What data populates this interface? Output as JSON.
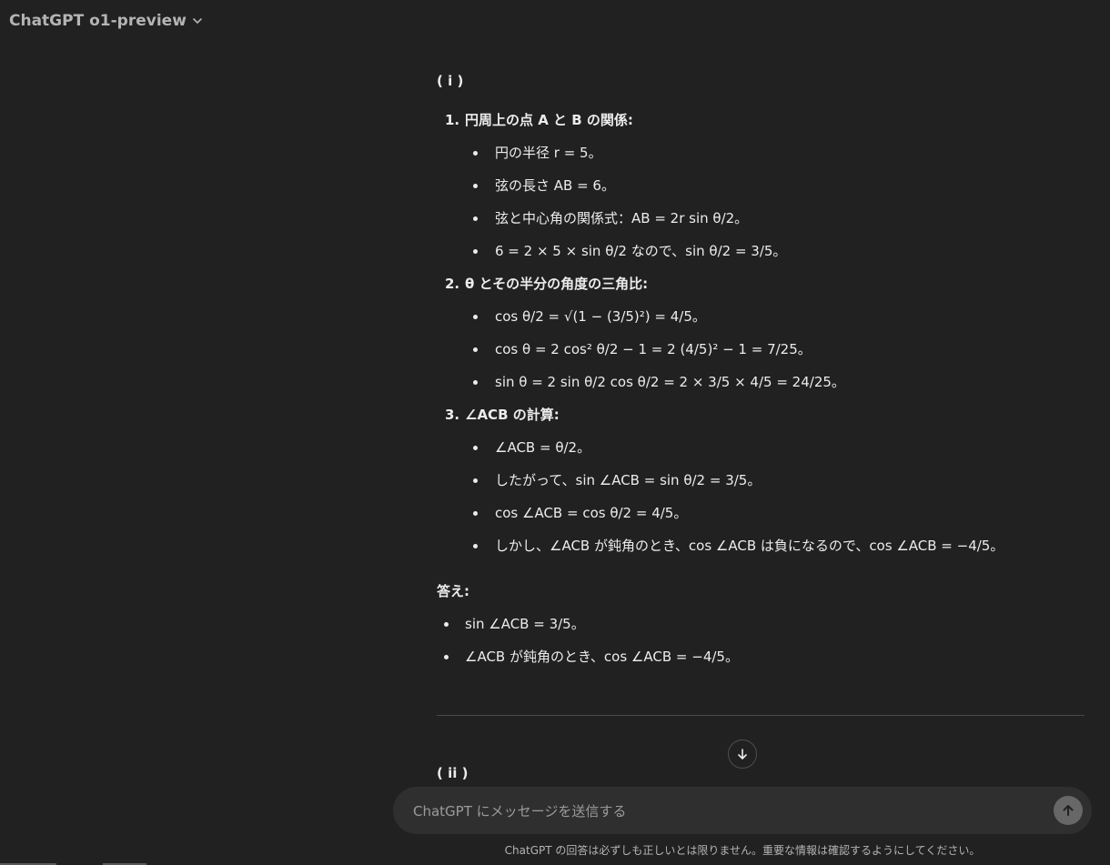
{
  "header": {
    "model_label": "ChatGPT o1-preview",
    "chevron_icon": "chevron-down-icon"
  },
  "message": {
    "section_i": "( i )",
    "steps": [
      {
        "number": "1.",
        "title": "円周上の点 A と B の関係:",
        "bullets": [
          "円の半径 r = 5。",
          "弦の長さ AB = 6。",
          "弦と中心角の関係式：AB = 2r sin θ/2。",
          "6 = 2 × 5 × sin θ/2 なので、sin θ/2 = 3/5。"
        ]
      },
      {
        "number": "2.",
        "title": "θ とその半分の角度の三角比:",
        "bullets": [
          "cos θ/2 = √(1 − (3/5)²) = 4/5。",
          "cos θ = 2 cos² θ/2 − 1 = 2 (4/5)² − 1 = 7/25。",
          "sin θ = 2 sin θ/2 cos θ/2 = 2 × 3/5 × 4/5 = 24/25。"
        ]
      },
      {
        "number": "3.",
        "title": "∠ACB の計算:",
        "bullets": [
          "∠ACB = θ/2。",
          "したがって、sin ∠ACB = sin θ/2 = 3/5。",
          "cos ∠ACB = cos θ/2 = 4/5。",
          "しかし、∠ACB が鈍角のとき、cos ∠ACB は負になるので、cos ∠ACB = −4/5。"
        ]
      }
    ],
    "answer_label": "答え:",
    "answers": [
      "sin ∠ACB = 3/5。",
      "∠ACB が鈍角のとき、cos ∠ACB = −4/5。"
    ],
    "section_ii": "( ii )"
  },
  "composer": {
    "placeholder": "ChatGPT にメッセージを送信する",
    "value": ""
  },
  "footer": {
    "disclaimer": "ChatGPT の回答は必ずしも正しいとは限りません。重要な情報は確認するようにしてください。"
  },
  "icons": {
    "scroll": "arrow-down-icon",
    "send": "arrow-up-icon"
  }
}
